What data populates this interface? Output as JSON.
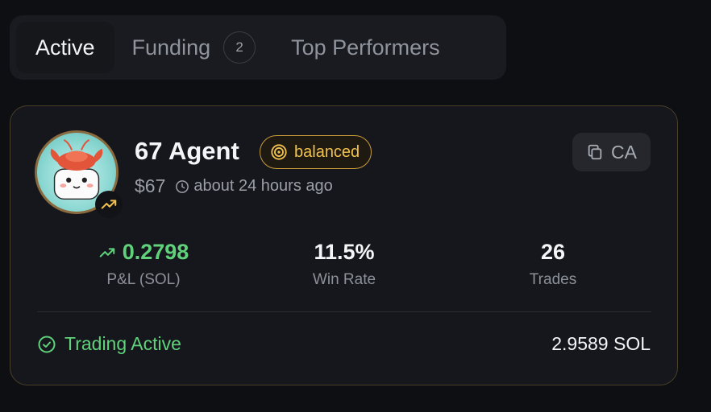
{
  "tabs": {
    "active": "Active",
    "funding": "Funding",
    "funding_count": "2",
    "top": "Top Performers"
  },
  "agent": {
    "name": "67 Agent",
    "style": "balanced",
    "price": "$67",
    "time": "about 24 hours ago",
    "ca_label": "CA",
    "avatar_icon": "lobster-avatar",
    "badge_icon": "trending-up-icon"
  },
  "stats": {
    "pnl_value": "0.2798",
    "pnl_label": "P&L (SOL)",
    "winrate_value": "11.5%",
    "winrate_label": "Win Rate",
    "trades_value": "26",
    "trades_label": "Trades"
  },
  "footer": {
    "status": "Trading Active",
    "balance": "2.9589 SOL"
  },
  "colors": {
    "accent_green": "#5fd27b",
    "badge_gold": "#f2c14e",
    "card_border": "#4a3f28"
  }
}
